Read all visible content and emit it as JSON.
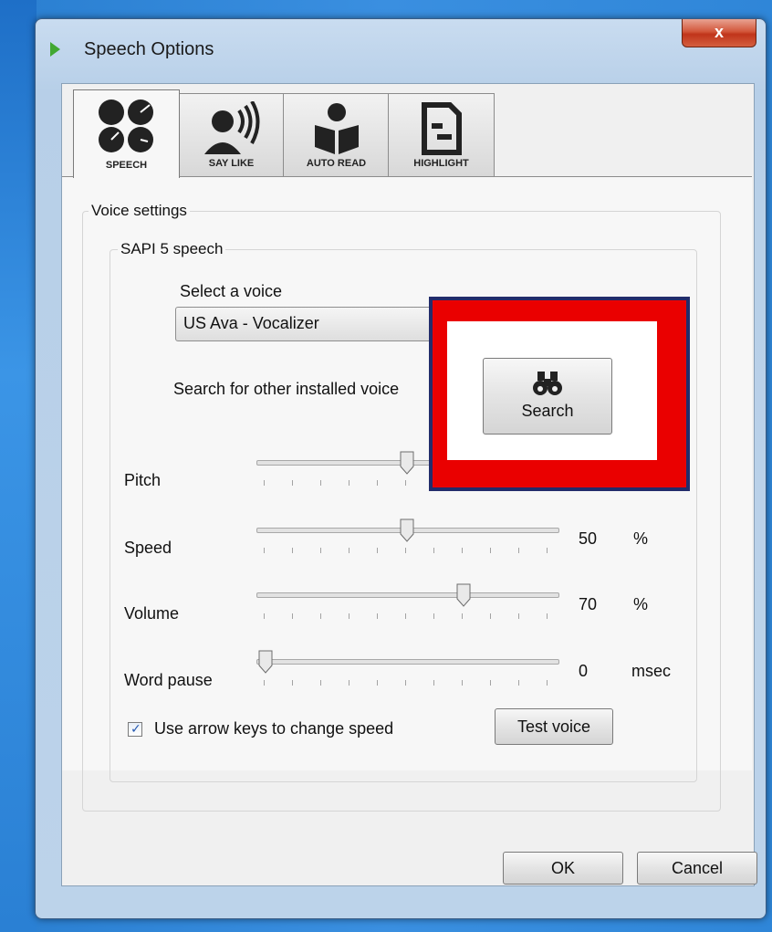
{
  "window": {
    "title": "Speech Options",
    "close_label": "x"
  },
  "tabs": [
    {
      "label": "SPEECH",
      "icon": "speech-dials-icon",
      "active": true
    },
    {
      "label": "SAY LIKE",
      "icon": "person-speaking-icon",
      "active": false
    },
    {
      "label": "AUTO READ",
      "icon": "person-reading-icon",
      "active": false
    },
    {
      "label": "HIGHLIGHT",
      "icon": "document-highlight-icon",
      "active": false
    }
  ],
  "voice_settings": {
    "group_title": "Voice settings",
    "sapi_group_title": "SAPI 5 speech",
    "select_voice_label": "Select a voice",
    "selected_voice": "US Ava - Vocalizer",
    "search_text": "Search for other installed voice",
    "search_button": "Search",
    "search_icon": "binoculars-icon"
  },
  "sliders": [
    {
      "label": "Pitch",
      "percent": 50,
      "value": "",
      "unit": ""
    },
    {
      "label": "Speed",
      "percent": 50,
      "value": "50",
      "unit": "%"
    },
    {
      "label": "Volume",
      "percent": 70,
      "value": "70",
      "unit": "%"
    },
    {
      "label": "Word pause",
      "percent": 0,
      "value": "0",
      "unit": "msec"
    }
  ],
  "arrow_keys": {
    "label": "Use arrow keys to change speed",
    "checked": true
  },
  "test_voice_button": "Test voice",
  "footer": {
    "ok": "OK",
    "cancel": "Cancel"
  },
  "colors": {
    "highlight": "#ea0000",
    "checkmark": "#2458b0"
  }
}
